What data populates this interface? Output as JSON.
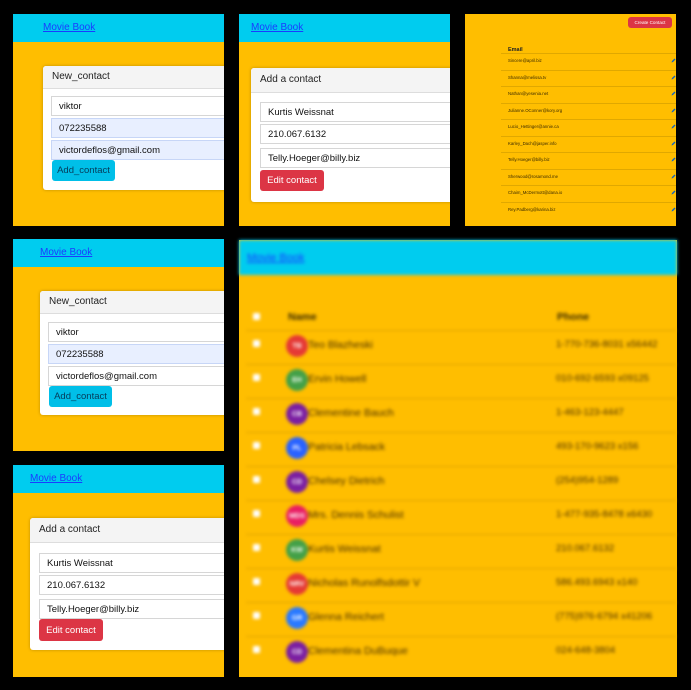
{
  "brand": "Movie Book",
  "new_contact_form": {
    "header": "New_contact",
    "name_value": "viktor",
    "phone_value": "072235588",
    "email_value": "victordeflos@gmail.com",
    "submit_label": "Add_contact"
  },
  "edit_contact_form": {
    "header": "Add a contact",
    "name_value": "Kurtis Weissnat",
    "phone_value": "210.067.6132",
    "email_value": "Telly.Hoeger@billy.biz",
    "submit_label": "Edit contact"
  },
  "email_list": {
    "create_button": "Create Contact",
    "column_header": "Email",
    "emails": [
      "Sincere@april.biz",
      "Shanna@melissa.tv",
      "Nathan@yesenia.net",
      "Julianne.OConner@kory.org",
      "Lucio_Hettinger@annie.ca",
      "Karley_Dach@jasper.info",
      "Telly.Hoeger@billy.biz",
      "Sherwood@rosamond.me",
      "Chaim_McDermott@dana.io",
      "Rey.Padberg@karina.biz"
    ]
  },
  "contact_list": {
    "columns": [
      "Name",
      "Phone"
    ],
    "rows": [
      {
        "initials": "TB",
        "name": "Teo Blazheski",
        "phone": "1-770-736-8031 x56442",
        "color": "#E53935"
      },
      {
        "initials": "EH",
        "name": "Ervin Howell",
        "phone": "010-692-6593 x09125",
        "color": "#43A047"
      },
      {
        "initials": "CB",
        "name": "Clementine Bauch",
        "phone": "1-463-123-4447",
        "color": "#7B1FA2"
      },
      {
        "initials": "PL",
        "name": "Patricia Lebsack",
        "phone": "493-170-9623 x156",
        "color": "#2962FF"
      },
      {
        "initials": "CD",
        "name": "Chelsey Dietrich",
        "phone": "(254)954-1289",
        "color": "#7B1FA2"
      },
      {
        "initials": "MDS",
        "name": "Mrs. Dennis Schulist",
        "phone": "1-477-935-8478 x6430",
        "color": "#E91E63"
      },
      {
        "initials": "KW",
        "name": "Kurtis Weissnat",
        "phone": "210.067.6132",
        "color": "#43A047"
      },
      {
        "initials": "NRV",
        "name": "Nicholas Runolfsdottir V",
        "phone": "586.493.6943 x140",
        "color": "#E53935"
      },
      {
        "initials": "GR",
        "name": "Glenna Reichert",
        "phone": "(775)976-6794 x41206",
        "color": "#2979FF"
      },
      {
        "initials": "CD",
        "name": "Clementina DuBuque",
        "phone": "024-648-3804",
        "color": "#7B1FA2"
      }
    ]
  }
}
